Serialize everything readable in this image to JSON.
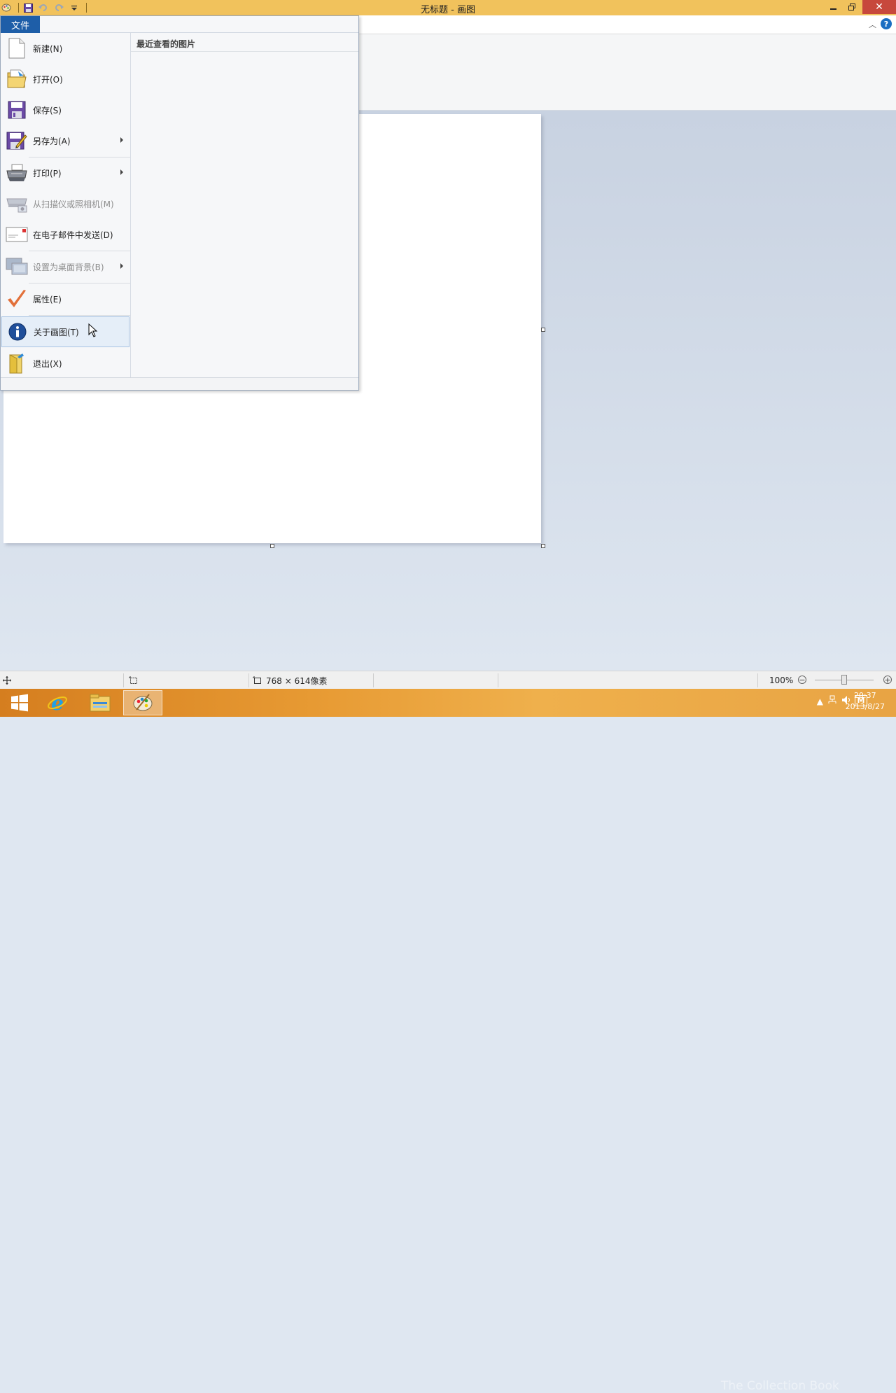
{
  "window": {
    "title": "无标题 - 画图"
  },
  "qat": {
    "icons": [
      "paint-app-icon",
      "save-icon",
      "undo-icon",
      "redo-icon",
      "customize-qat-icon"
    ]
  },
  "file_tab": {
    "label": "文件"
  },
  "file_menu": {
    "items": [
      {
        "label": "新建(N)",
        "icon": "new-document-icon",
        "enabled": true
      },
      {
        "label": "打开(O)",
        "icon": "open-folder-icon",
        "enabled": true
      },
      {
        "label": "保存(S)",
        "icon": "save-icon",
        "enabled": true
      },
      {
        "label": "另存为(A)",
        "icon": "save-as-icon",
        "enabled": true,
        "submenu": true
      },
      {
        "label": "打印(P)",
        "icon": "printer-icon",
        "enabled": true,
        "submenu": true
      },
      {
        "label": "从扫描仪或照相机(M)",
        "icon": "scanner-icon",
        "enabled": false
      },
      {
        "label": "在电子邮件中发送(D)",
        "icon": "email-icon",
        "enabled": true
      },
      {
        "label": "设置为桌面背景(B)",
        "icon": "desktop-background-icon",
        "enabled": false,
        "submenu": true
      },
      {
        "label": "属性(E)",
        "icon": "properties-checkmark-icon",
        "enabled": true
      },
      {
        "label": "关于画图(T)",
        "icon": "info-icon",
        "enabled": true,
        "hovered": true
      },
      {
        "label": "退出(X)",
        "icon": "exit-icon",
        "enabled": true
      }
    ],
    "recent_header": "最近查看的图片"
  },
  "statusbar": {
    "dimensions": "768 × 614像素",
    "zoom_level": "100%",
    "zoom_fraction": 0.5
  },
  "taskbar": {
    "items": [
      "windows-start-icon",
      "internet-explorer-icon",
      "file-explorer-icon",
      "paint-icon"
    ],
    "clock_time": "20:37",
    "clock_date": "2013/8/27",
    "watermark": "The Collection Book",
    "ime_label": "M"
  },
  "colors": {
    "titlebar": "#f1c25c",
    "file_tab": "#1e5ea8",
    "close_button": "#c7483c",
    "taskbar": "#e79a33"
  }
}
